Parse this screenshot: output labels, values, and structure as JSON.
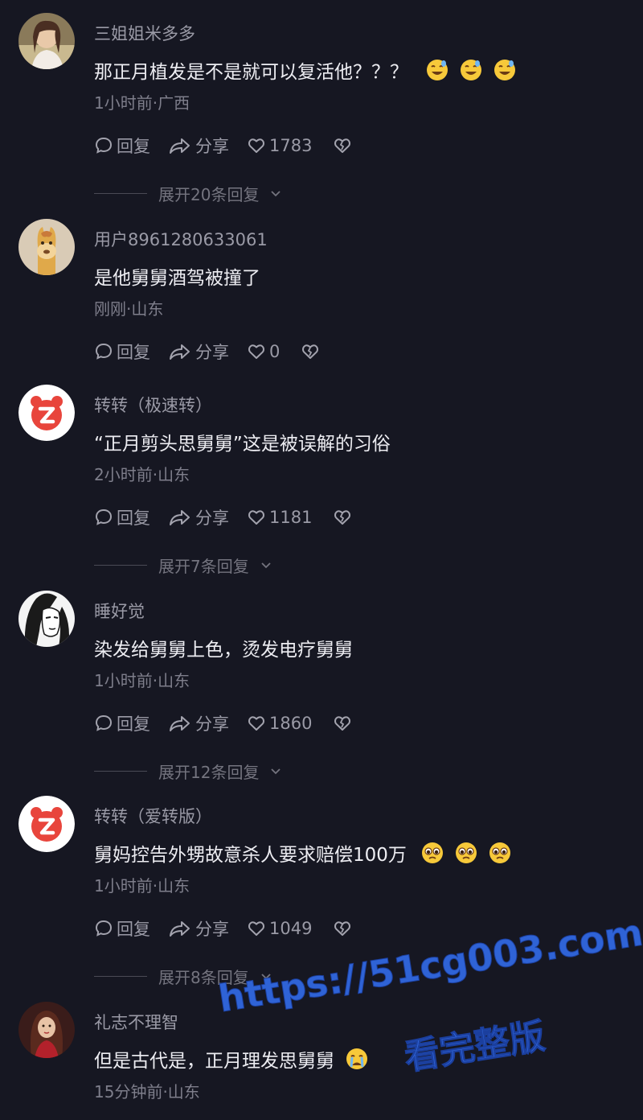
{
  "labels": {
    "reply": "回复",
    "share": "分享"
  },
  "comments": [
    {
      "username": "三姐姐米多多",
      "text": "那正月植发是不是就可以复活他？？？",
      "emoji_count": 3,
      "emoji": "sweat-smile-emoji",
      "meta": "1小时前·广西",
      "likes": "1783",
      "expand": "展开20条回复",
      "avatar": "photo-girl-avatar"
    },
    {
      "username": "用户8961280633061",
      "text": "是他舅舅酒驾被撞了",
      "emoji_count": 0,
      "meta": "刚刚·山东",
      "likes": "0",
      "expand": "",
      "avatar": "llama-avatar"
    },
    {
      "username": "转转（极速转）",
      "text": "“正月剪头思舅舅”这是被误解的习俗",
      "emoji_count": 0,
      "meta": "2小时前·山东",
      "likes": "1181",
      "expand": "展开7条回复",
      "avatar": "zhuanzhuan-logo-avatar"
    },
    {
      "username": "睡好觉",
      "text": "染发给舅舅上色，烫发电疗舅舅",
      "emoji_count": 0,
      "meta": "1小时前·山东",
      "likes": "1860",
      "expand": "展开12条回复",
      "avatar": "sketch-face-avatar"
    },
    {
      "username": "转转（爱转版）",
      "text": "舅妈控告外甥故意杀人要求赔偿100万",
      "emoji_count": 3,
      "emoji": "pleading-emoji",
      "meta": "1小时前·山东",
      "likes": "1049",
      "expand": "展开8条回复",
      "avatar": "zhuanzhuan-logo-avatar"
    },
    {
      "username": "礼志不理智",
      "text": "但是古代是，正月理发思舅舅",
      "emoji_count": 1,
      "emoji": "crying-emoji",
      "meta": "15分钟前·山东",
      "likes": "",
      "expand": "",
      "avatar": "photo-woman-avatar"
    }
  ],
  "watermark": {
    "url": "https://51cg003.com",
    "subtitle": "看完整版"
  },
  "colors": {
    "background": "#161722",
    "username": "#9a9aa6",
    "text": "#ededf2",
    "meta": "#7e7e8b",
    "zhuanzhuan_red": "#e8453c",
    "watermark_blue": "#2f63d6"
  }
}
